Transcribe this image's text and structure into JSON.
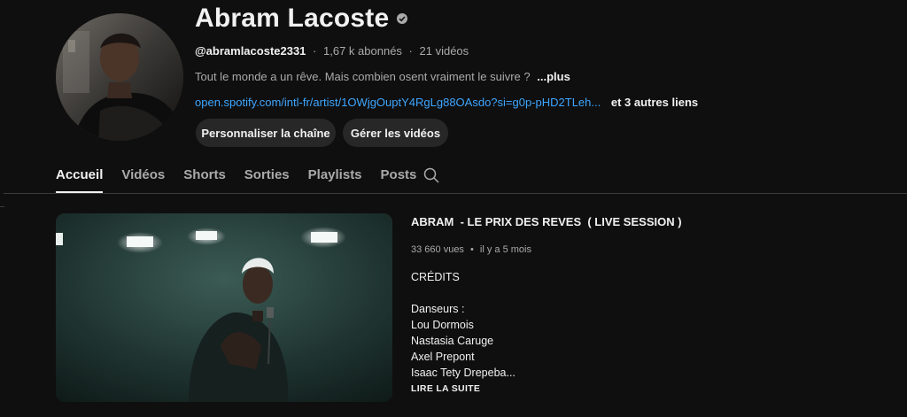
{
  "channel": {
    "name": "Abram Lacoste",
    "handle": "@abramlacoste2331",
    "subscribers": "1,67 k abonnés",
    "video_count": "21 vidéos",
    "separator": "·",
    "description": "Tout le monde a un rêve. Mais combien osent vraiment le suivre ?",
    "more_label": "...plus",
    "link": "open.spotify.com/intl-fr/artist/1OWjgOuptY4RgLg88OAsdo?si=g0p-pHD2TLeh...",
    "other_links": "et 3 autres liens",
    "verified_icon": "verified-icon",
    "buttons": {
      "customize": "Personnaliser la chaîne",
      "manage": "Gérer les vidéos"
    }
  },
  "tabs": [
    {
      "label": "Accueil",
      "active": true
    },
    {
      "label": "Vidéos",
      "active": false
    },
    {
      "label": "Shorts",
      "active": false
    },
    {
      "label": "Sorties",
      "active": false
    },
    {
      "label": "Playlists",
      "active": false
    },
    {
      "label": "Posts",
      "active": false
    }
  ],
  "search_icon": "search-icon",
  "featured_video": {
    "title": "ABRAM  - LE PRIX DES REVES  ( LIVE SESSION )",
    "views": "33 660 vues",
    "separator": "•",
    "age": "il y a 5 mois",
    "description_lines": [
      "CRÉDITS",
      "",
      "Danseurs :",
      "Lou Dormois",
      "Nastasia Caruge",
      "Axel Prepont",
      "Isaac Tety Drepeba..."
    ],
    "read_more": "LIRE LA SUITE"
  },
  "colors": {
    "background": "#0f0f0f",
    "link": "#3ea6ff",
    "button_bg": "#272727",
    "secondary_text": "#aaaaaa"
  }
}
